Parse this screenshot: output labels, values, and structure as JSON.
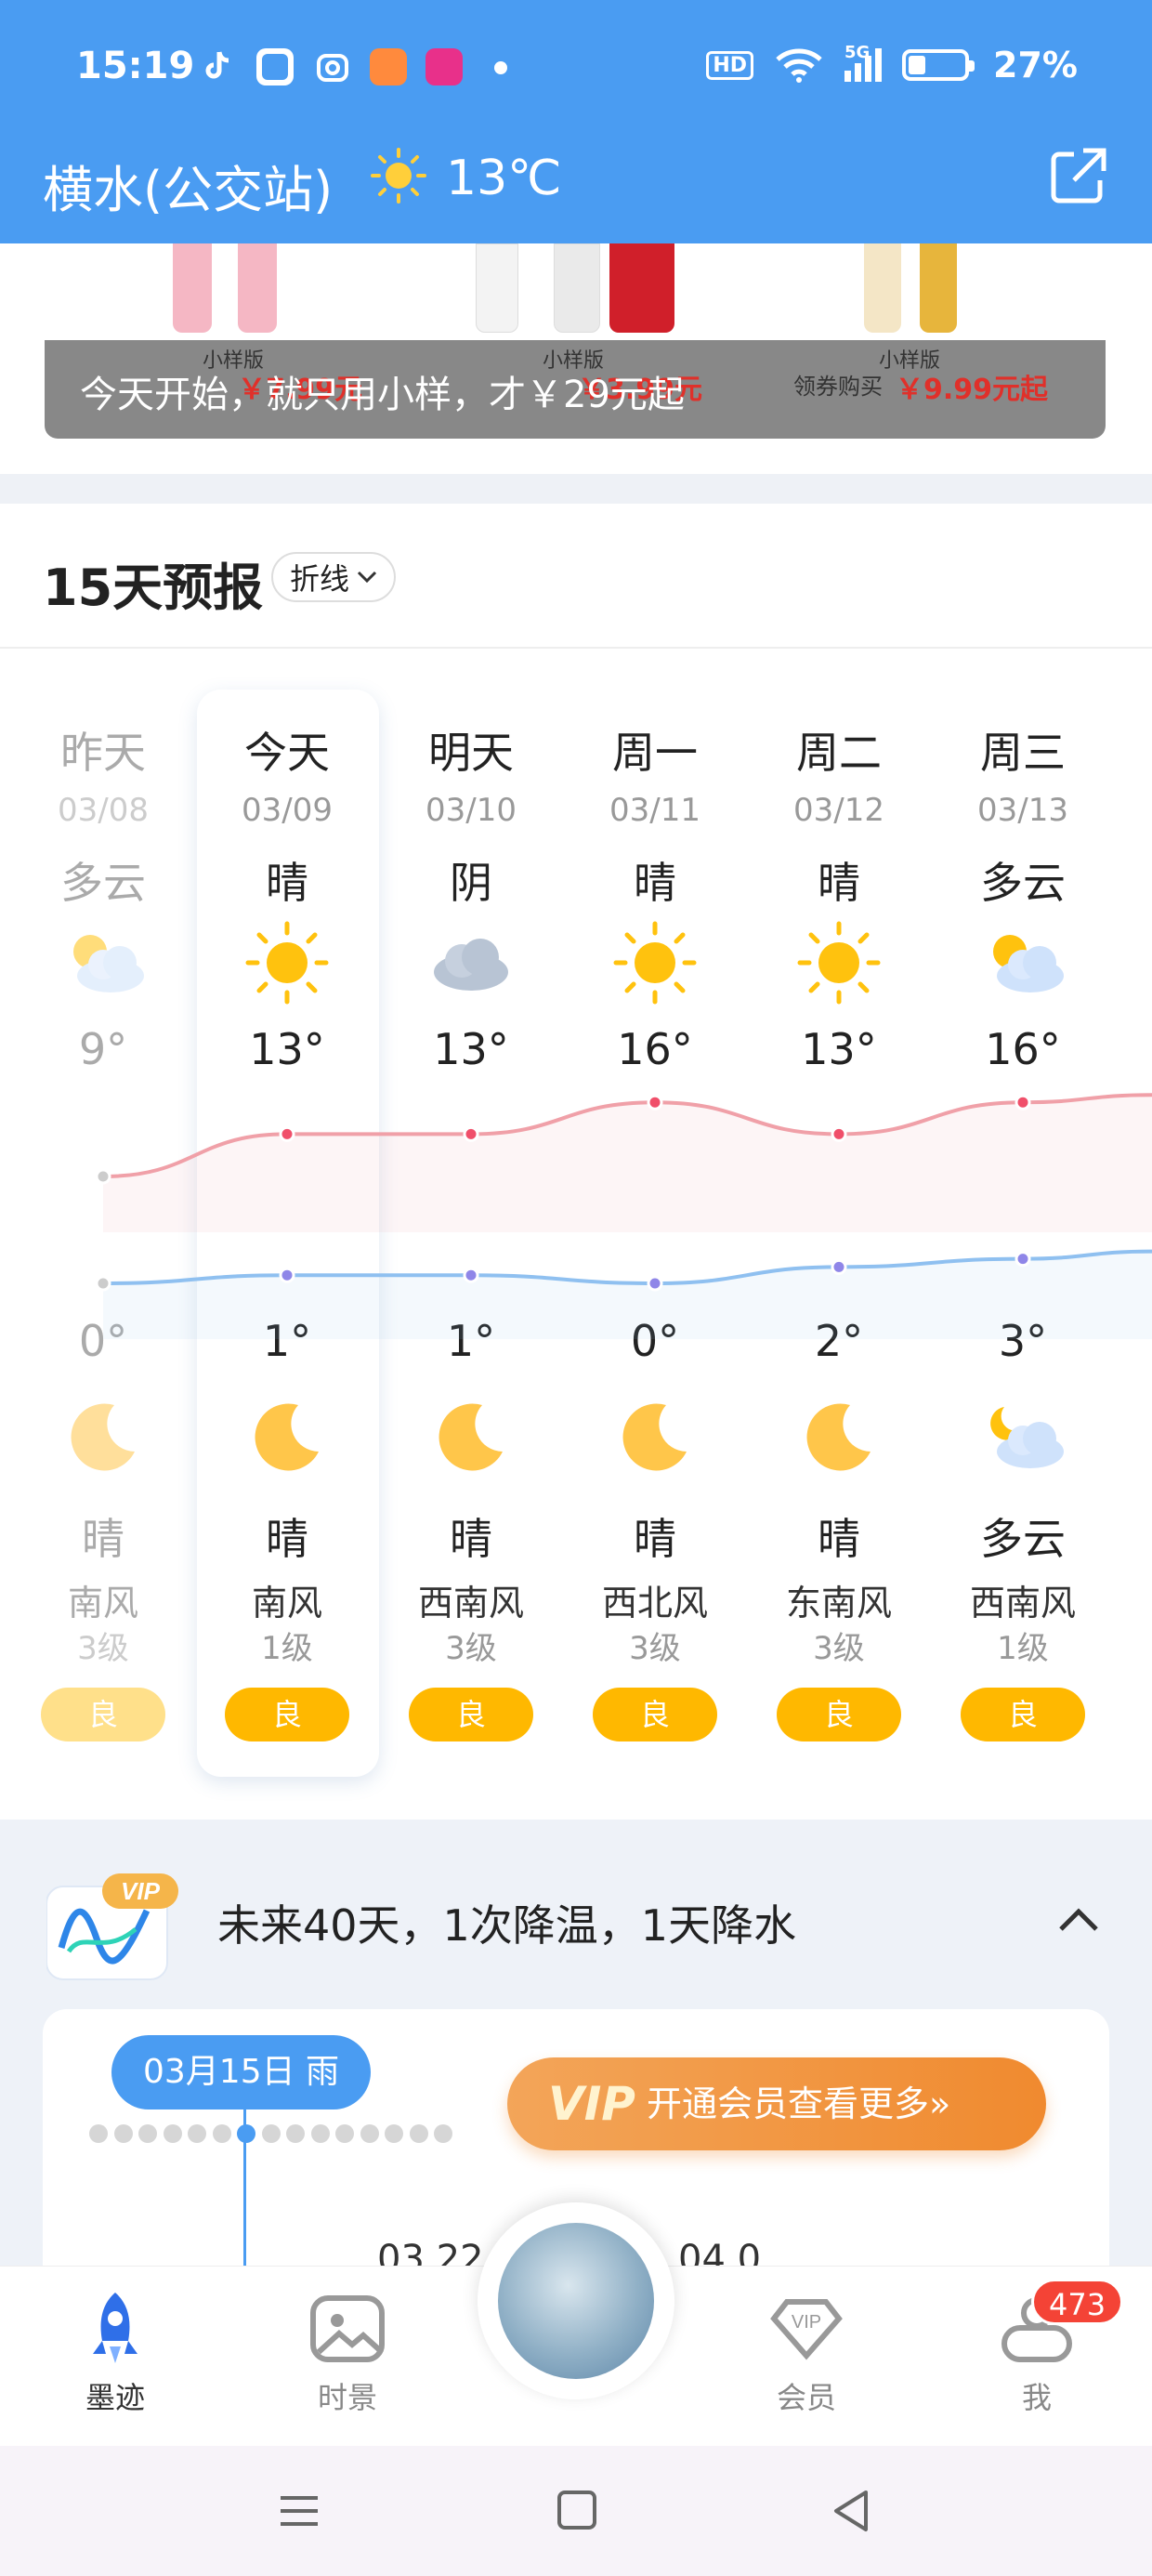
{
  "status_bar": {
    "time": "15:19",
    "hd": "HD",
    "signal": "5G",
    "battery": "27%"
  },
  "header": {
    "location": "横水(公交站)",
    "temperature": "13℃",
    "weather_icon": "sun-icon"
  },
  "ad": {
    "text": "今天开始，就只用小样，才￥29元起",
    "items": [
      {
        "tag": "小样版",
        "price": "￥7.99元"
      },
      {
        "tag": "小样版",
        "price": "￥3.99元"
      },
      {
        "tag": "小样版",
        "price": "￥9.99元起"
      }
    ],
    "coupon": "领券购买"
  },
  "forecast": {
    "title": "15天预报",
    "mode": "折线",
    "days": [
      {
        "weekday": "昨天",
        "date": "03/08",
        "day_cond": "多云",
        "high": "9°",
        "low": "0°",
        "night_cond": "晴",
        "wind": "南风",
        "wind_level": "3级",
        "aqi": "良",
        "day_icon": "partly-cloudy-icon",
        "night_icon": "moon-icon",
        "past": true
      },
      {
        "weekday": "今天",
        "date": "03/09",
        "day_cond": "晴",
        "high": "13°",
        "low": "1°",
        "night_cond": "晴",
        "wind": "南风",
        "wind_level": "1级",
        "aqi": "良",
        "day_icon": "sun-icon",
        "night_icon": "moon-icon",
        "past": false
      },
      {
        "weekday": "明天",
        "date": "03/10",
        "day_cond": "阴",
        "high": "13°",
        "low": "1°",
        "night_cond": "晴",
        "wind": "西南风",
        "wind_level": "3级",
        "aqi": "良",
        "day_icon": "cloud-icon",
        "night_icon": "moon-icon",
        "past": false
      },
      {
        "weekday": "周一",
        "date": "03/11",
        "day_cond": "晴",
        "high": "16°",
        "low": "0°",
        "night_cond": "晴",
        "wind": "西北风",
        "wind_level": "3级",
        "aqi": "良",
        "day_icon": "sun-icon",
        "night_icon": "moon-icon",
        "past": false
      },
      {
        "weekday": "周二",
        "date": "03/12",
        "day_cond": "晴",
        "high": "13°",
        "low": "2°",
        "night_cond": "晴",
        "wind": "东南风",
        "wind_level": "3级",
        "aqi": "良",
        "day_icon": "sun-icon",
        "night_icon": "moon-icon",
        "past": false
      },
      {
        "weekday": "周三",
        "date": "03/13",
        "day_cond": "多云",
        "high": "16°",
        "low": "3°",
        "night_cond": "多云",
        "wind": "西南风",
        "wind_level": "1级",
        "aqi": "良",
        "day_icon": "partly-cloudy-icon",
        "night_icon": "partly-cloudy-night-icon",
        "past": false
      }
    ],
    "high_values": [
      9,
      13,
      13,
      16,
      13,
      16
    ],
    "low_values": [
      0,
      1,
      1,
      0,
      2,
      3
    ],
    "colors": {
      "high_line": "#f0a0a8",
      "low_line": "#8fc0f0",
      "aqi_good": "#ffb800"
    }
  },
  "long_range": {
    "summary": "未来40天，1次降温，1天降水",
    "vip_tag": "VIP",
    "bubble": "03月15日 雨",
    "vip_button": "开通会员查看更多»",
    "vip_word": "VIP",
    "axis_labels": [
      "03.22",
      "04.0"
    ]
  },
  "bottom_nav": {
    "items": [
      {
        "label": "墨迹",
        "icon": "rocket-icon"
      },
      {
        "label": "时景",
        "icon": "photo-icon"
      },
      {
        "label": "会员",
        "icon": "vip-diamond-icon"
      },
      {
        "label": "我",
        "icon": "profile-icon"
      }
    ],
    "badge": "473"
  }
}
